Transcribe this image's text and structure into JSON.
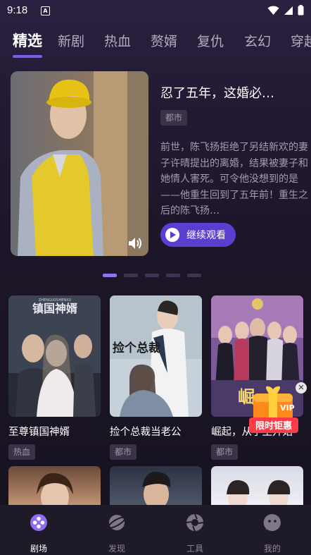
{
  "status_bar": {
    "time": "9:18"
  },
  "tabs": [
    {
      "label": "精选"
    },
    {
      "label": "新剧"
    },
    {
      "label": "热血"
    },
    {
      "label": "赘婿"
    },
    {
      "label": "复仇"
    },
    {
      "label": "玄幻"
    },
    {
      "label": "穿越"
    }
  ],
  "featured": {
    "title": "忍了五年，这婚必…",
    "tag": "都市",
    "description": "前世，陈飞扬拒绝了另结新欢的妻子许晴提出的离婚，结果被妻子和她情人害死。可令他没想到的是——他重生回到了五年前！重生之后的陈飞扬…",
    "watch_label": "继续观看"
  },
  "carousel": {
    "count": 5,
    "active": 0
  },
  "dramas": [
    {
      "title": "至尊镇国神婿",
      "tag": "热血",
      "poster_text": "镇国神婿",
      "poster_sub": "ZHENGUOSHENXU"
    },
    {
      "title": "捡个总裁当老公",
      "tag": "都市",
      "poster_text": "捡个总裁"
    },
    {
      "title": "崛起，从学生开始",
      "tag": "都市",
      "poster_text": "崛"
    }
  ],
  "promo": {
    "line1": "VIP",
    "line2": "限时钜惠"
  },
  "bottom_nav": [
    {
      "label": "剧场",
      "icon": "theater-icon",
      "active": true
    },
    {
      "label": "发现",
      "icon": "planet-icon",
      "active": false
    },
    {
      "label": "工具",
      "icon": "aperture-icon",
      "active": false
    },
    {
      "label": "我的",
      "icon": "chat-face-icon",
      "active": false
    }
  ],
  "colors": {
    "accent": "#7b5cf0",
    "button": "#5b3ecf",
    "background": "#1b1526"
  }
}
